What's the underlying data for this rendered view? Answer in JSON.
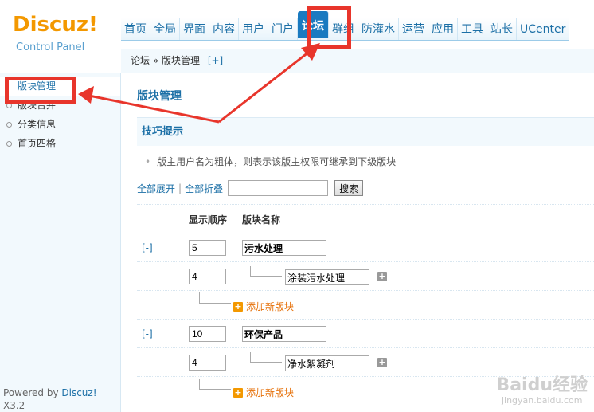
{
  "logo": {
    "main": "Discuz!",
    "sub": "Control Panel"
  },
  "nav": [
    {
      "label": "首页"
    },
    {
      "label": "全局"
    },
    {
      "label": "界面"
    },
    {
      "label": "内容"
    },
    {
      "label": "用户"
    },
    {
      "label": "门户"
    },
    {
      "label": "论坛",
      "active": true
    },
    {
      "label": "群组"
    },
    {
      "label": "防灌水"
    },
    {
      "label": "运营"
    },
    {
      "label": "应用"
    },
    {
      "label": "工具"
    },
    {
      "label": "站长"
    },
    {
      "label": "UCenter"
    }
  ],
  "breadcrumb": {
    "path": "论坛 » 版块管理",
    "plus": "[+]"
  },
  "sidebar": {
    "items": [
      {
        "label": "版块管理",
        "active": true
      },
      {
        "label": "版块合并"
      },
      {
        "label": "分类信息"
      },
      {
        "label": "首页四格"
      }
    ],
    "powered_prefix": "Powered by ",
    "powered_link": "Discuz!",
    "powered_suffix": " X3.2"
  },
  "main": {
    "title": "版块管理",
    "tips_title": "技巧提示",
    "tip": "版主用户名为粗体，则表示该版主权限可继承到下级版块",
    "expand_all": "全部展开",
    "collapse_all": "全部折叠",
    "search_value": "",
    "search_button": "搜索",
    "col_order": "显示顺序",
    "col_name": "版块名称",
    "groups": [
      {
        "toggle": "[-]",
        "order": "5",
        "name": "污水处理",
        "sub_order": "4",
        "sub_name": "涂装污水处理",
        "add_label": "添加新版块"
      },
      {
        "toggle": "[-]",
        "order": "10",
        "name": "环保产品",
        "sub_order": "4",
        "sub_name": "净水絮凝剂",
        "add_label": "添加新版块"
      }
    ]
  },
  "watermark": {
    "brand": "Baidu经验",
    "url": "jingyan.baidu.com"
  },
  "colors": {
    "accent": "#1b6fa6",
    "highlight": "#e8352b",
    "orange": "#f39800"
  }
}
